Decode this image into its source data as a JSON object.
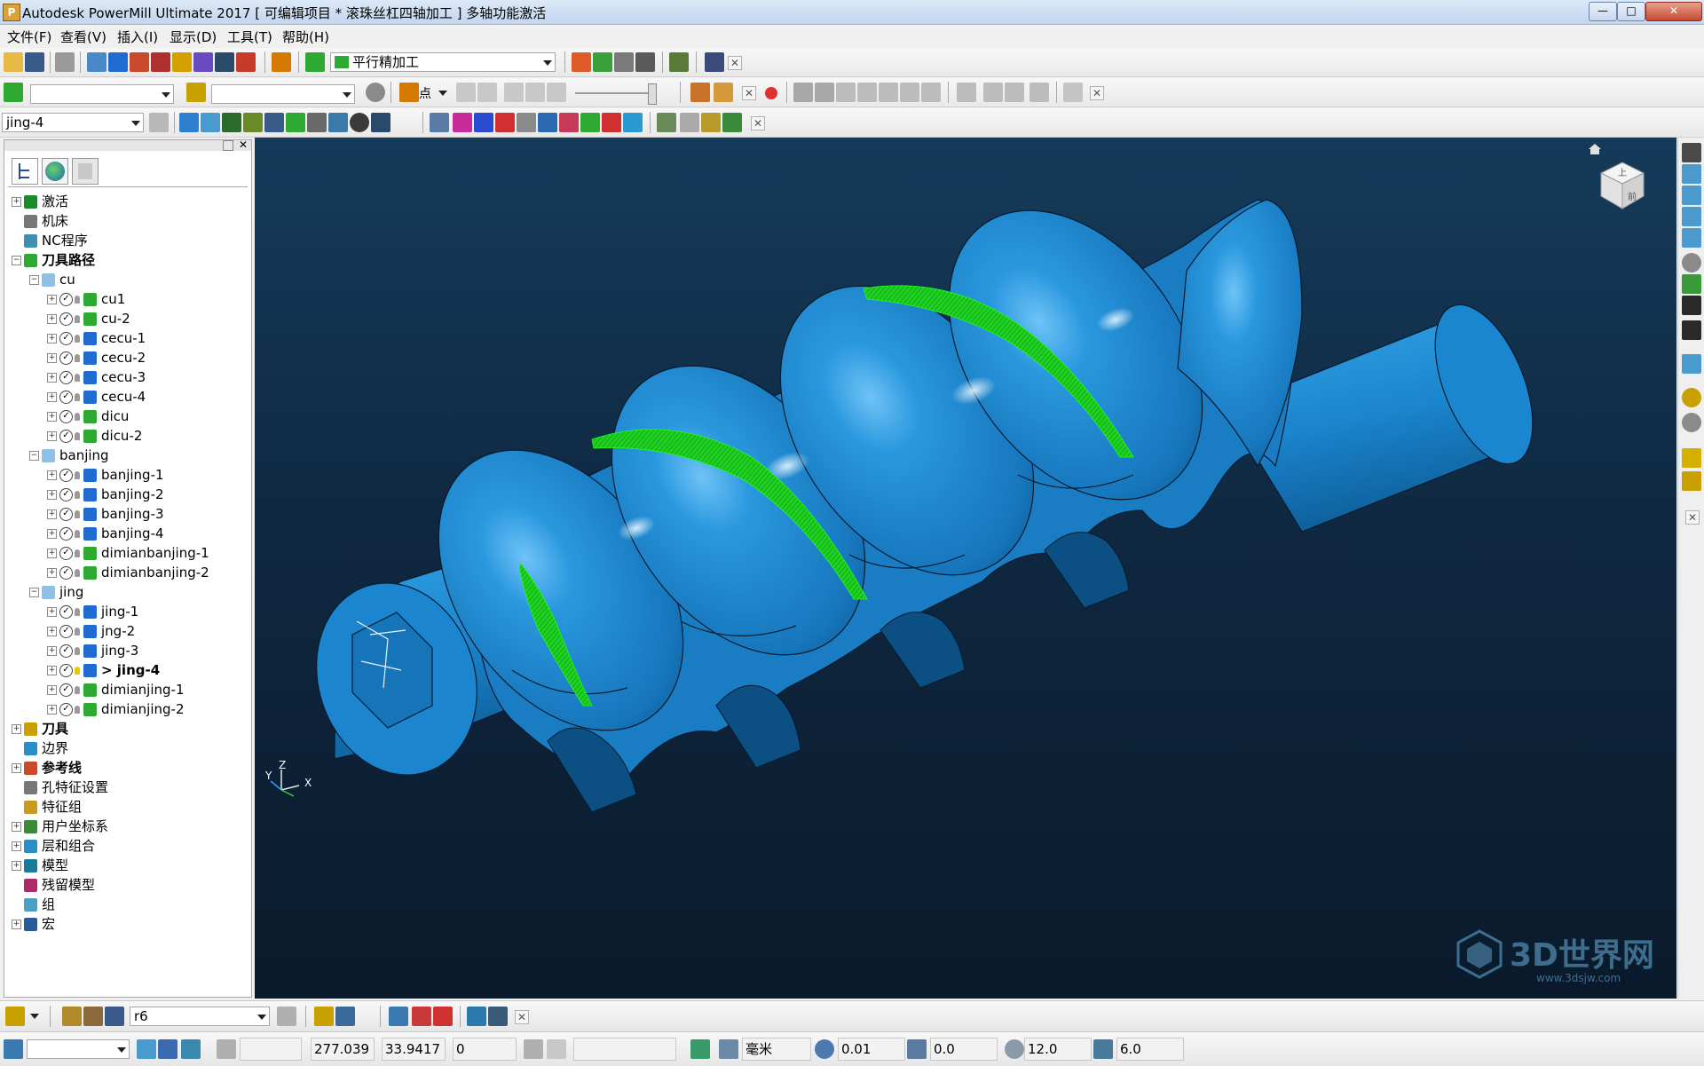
{
  "window": {
    "title": "Autodesk PowerMill Ultimate 2017   [ 可编辑项目 * 滚珠丝杠四轴加工 ]    多轴功能激活",
    "minimize_label": "—",
    "maximize_label": "□",
    "close_label": "✕"
  },
  "menu": [
    "文件(F)",
    "查看(V)",
    "插入(I)",
    "显示(D)",
    "工具(T)",
    "帮助(H)"
  ],
  "toolbar1": {
    "strategy_combo": "平行精加工"
  },
  "toolbar3": {
    "toolpath_combo": "jing-4"
  },
  "toolbar2": {
    "point_label": "点"
  },
  "tree": [
    {
      "label": "激活",
      "level": 0,
      "expander": "+",
      "icon": "play-icon",
      "icon_color": "#1d8a2a",
      "bold": false
    },
    {
      "label": "机床",
      "level": 0,
      "expander": "",
      "icon": "machine-icon",
      "icon_color": "#777777",
      "bold": false
    },
    {
      "label": "NC程序",
      "level": 0,
      "expander": "",
      "icon": "nc-program-icon",
      "icon_color": "#3f8fb0",
      "bold": false
    },
    {
      "label": "刀具路径",
      "level": 0,
      "expander": "−",
      "icon": "toolpath-folder-icon",
      "icon_color": "#2eaa33",
      "bold": true
    },
    {
      "label": "cu",
      "level": 1,
      "expander": "−",
      "icon": "folder-icon",
      "icon_color": "#8fc1e4",
      "bold": false
    },
    {
      "label": "cu1",
      "level": 2,
      "expander": "+",
      "icon": "area-clear-icon",
      "icon_color": "#2eaa33",
      "bold": false,
      "item": true
    },
    {
      "label": "cu-2",
      "level": 2,
      "expander": "+",
      "icon": "area-clear-icon",
      "icon_color": "#2eaa33",
      "bold": false,
      "item": true
    },
    {
      "label": "cecu-1",
      "level": 2,
      "expander": "+",
      "icon": "swarf-icon",
      "icon_color": "#1f6bd0",
      "bold": false,
      "item": true
    },
    {
      "label": "cecu-2",
      "level": 2,
      "expander": "+",
      "icon": "swarf-icon",
      "icon_color": "#1f6bd0",
      "bold": false,
      "item": true
    },
    {
      "label": "cecu-3",
      "level": 2,
      "expander": "+",
      "icon": "swarf-icon",
      "icon_color": "#1f6bd0",
      "bold": false,
      "item": true
    },
    {
      "label": "cecu-4",
      "level": 2,
      "expander": "+",
      "icon": "swarf-icon",
      "icon_color": "#1f6bd0",
      "bold": false,
      "item": true
    },
    {
      "label": "dicu",
      "level": 2,
      "expander": "+",
      "icon": "raster-icon",
      "icon_color": "#2eaa33",
      "bold": false,
      "item": true
    },
    {
      "label": "dicu-2",
      "level": 2,
      "expander": "+",
      "icon": "raster-icon",
      "icon_color": "#2eaa33",
      "bold": false,
      "item": true
    },
    {
      "label": "banjing",
      "level": 1,
      "expander": "−",
      "icon": "folder-icon",
      "icon_color": "#8fc1e4",
      "bold": false
    },
    {
      "label": "banjing-1",
      "level": 2,
      "expander": "+",
      "icon": "swarf-icon",
      "icon_color": "#1f6bd0",
      "bold": false,
      "item": true
    },
    {
      "label": "banjing-2",
      "level": 2,
      "expander": "+",
      "icon": "swarf-icon",
      "icon_color": "#1f6bd0",
      "bold": false,
      "item": true
    },
    {
      "label": "banjing-3",
      "level": 2,
      "expander": "+",
      "icon": "swarf-icon",
      "icon_color": "#1f6bd0",
      "bold": false,
      "item": true
    },
    {
      "label": "banjing-4",
      "level": 2,
      "expander": "+",
      "icon": "swarf-icon",
      "icon_color": "#1f6bd0",
      "bold": false,
      "item": true
    },
    {
      "label": "dimianbanjing-1",
      "level": 2,
      "expander": "+",
      "icon": "raster-icon",
      "icon_color": "#2eaa33",
      "bold": false,
      "item": true
    },
    {
      "label": "dimianbanjing-2",
      "level": 2,
      "expander": "+",
      "icon": "raster-icon",
      "icon_color": "#2eaa33",
      "bold": false,
      "item": true
    },
    {
      "label": "jing",
      "level": 1,
      "expander": "−",
      "icon": "folder-icon",
      "icon_color": "#8fc1e4",
      "bold": false
    },
    {
      "label": "jing-1",
      "level": 2,
      "expander": "+",
      "icon": "swarf-icon",
      "icon_color": "#1f6bd0",
      "bold": false,
      "item": true
    },
    {
      "label": "jng-2",
      "level": 2,
      "expander": "+",
      "icon": "swarf-icon",
      "icon_color": "#1f6bd0",
      "bold": false,
      "item": true
    },
    {
      "label": "jing-3",
      "level": 2,
      "expander": "+",
      "icon": "swarf-icon",
      "icon_color": "#1f6bd0",
      "bold": false,
      "item": true
    },
    {
      "label": "> jing-4",
      "level": 2,
      "expander": "+",
      "icon": "swarf-icon",
      "icon_color": "#1f6bd0",
      "bold": true,
      "item": true,
      "active": true
    },
    {
      "label": "dimianjing-1",
      "level": 2,
      "expander": "+",
      "icon": "raster-icon",
      "icon_color": "#2eaa33",
      "bold": false,
      "item": true
    },
    {
      "label": "dimianjing-2",
      "level": 2,
      "expander": "+",
      "icon": "raster-icon",
      "icon_color": "#2eaa33",
      "bold": false,
      "item": true
    },
    {
      "label": "刀具",
      "level": 0,
      "expander": "+",
      "icon": "tool-icon",
      "icon_color": "#c8a000",
      "bold": true
    },
    {
      "label": "边界",
      "level": 0,
      "expander": "",
      "icon": "boundary-icon",
      "icon_color": "#2a8fc8",
      "bold": false
    },
    {
      "label": "参考线",
      "level": 0,
      "expander": "+",
      "icon": "pattern-icon",
      "icon_color": "#c84a2a",
      "bold": true
    },
    {
      "label": "孔特征设置",
      "level": 0,
      "expander": "",
      "icon": "hole-feature-icon",
      "icon_color": "#777777",
      "bold": false
    },
    {
      "label": "特征组",
      "level": 0,
      "expander": "",
      "icon": "feature-group-icon",
      "icon_color": "#c89a20",
      "bold": false
    },
    {
      "label": "用户坐标系",
      "level": 0,
      "expander": "+",
      "icon": "workplane-icon",
      "icon_color": "#3a8a3a",
      "bold": false
    },
    {
      "label": "层和组合",
      "level": 0,
      "expander": "+",
      "icon": "levels-icon",
      "icon_color": "#2a8fc8",
      "bold": false
    },
    {
      "label": "模型",
      "level": 0,
      "expander": "+",
      "icon": "model-icon",
      "icon_color": "#1a7a9a",
      "bold": false
    },
    {
      "label": "残留模型",
      "level": 0,
      "expander": "",
      "icon": "stock-model-icon",
      "icon_color": "#b02a6a",
      "bold": false
    },
    {
      "label": "组",
      "level": 0,
      "expander": "",
      "icon": "group-icon",
      "icon_color": "#4aa0c0",
      "bold": false
    },
    {
      "label": "宏",
      "level": 0,
      "expander": "+",
      "icon": "macro-icon",
      "icon_color": "#2a5a9a",
      "bold": false
    }
  ],
  "viewport": {
    "axis_z": "Z",
    "axis_y": "Y",
    "axis_x": "X",
    "viewcube_top": "上",
    "viewcube_front": "前",
    "home_icon": "home-icon",
    "model_color": "#1f8fd6",
    "toolpath_color": "#19e01a",
    "watermark_brand": "3D世界网",
    "watermark_url": "www.3dsjw.com"
  },
  "status1": {
    "tool_combo": "r6"
  },
  "status2": {
    "x": "277.039",
    "y": "33.9417",
    "z": "0",
    "unit": "毫米",
    "tolerance": "0.01",
    "thickness": "0.0",
    "diameter": "12.0",
    "stepover": "6.0"
  }
}
